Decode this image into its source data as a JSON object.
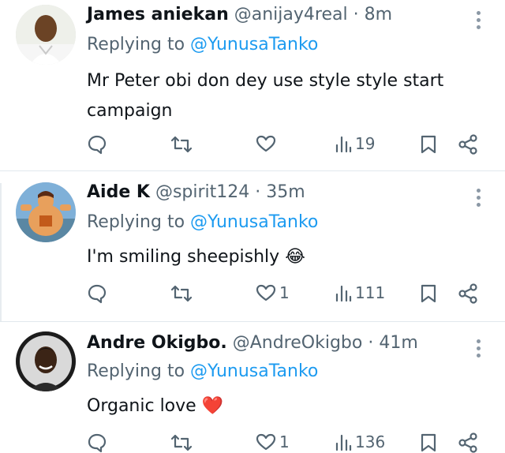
{
  "replies": [
    {
      "name": "James aniekan",
      "handle": "@anijay4real",
      "dot": "·",
      "time": "8m",
      "replying_prefix": "Replying to ",
      "replying_to": "@YunusaTanko",
      "text_line1": "Mr Peter obi don dey use style style start",
      "text_line2": "campaign",
      "views": "19",
      "likes": ""
    },
    {
      "name": "Aide K",
      "handle": "@spirit124",
      "dot": "·",
      "time": "35m",
      "replying_prefix": "Replying to ",
      "replying_to": "@YunusaTanko",
      "text_line1": "I'm smiling sheepishly",
      "emoji": "😂",
      "views": "111",
      "likes": "1"
    },
    {
      "name": "Andre Okigbo.",
      "handle": "@AndreOkigbo",
      "dot": "·",
      "time": "41m",
      "replying_prefix": "Replying to ",
      "replying_to": "@YunusaTanko",
      "text_line1": "Organic love",
      "emoji": "❤️",
      "views": "136",
      "likes": "1"
    }
  ],
  "colors": {
    "link": "#1d9bf0",
    "muted": "#536471",
    "heart": "#e0245e"
  }
}
